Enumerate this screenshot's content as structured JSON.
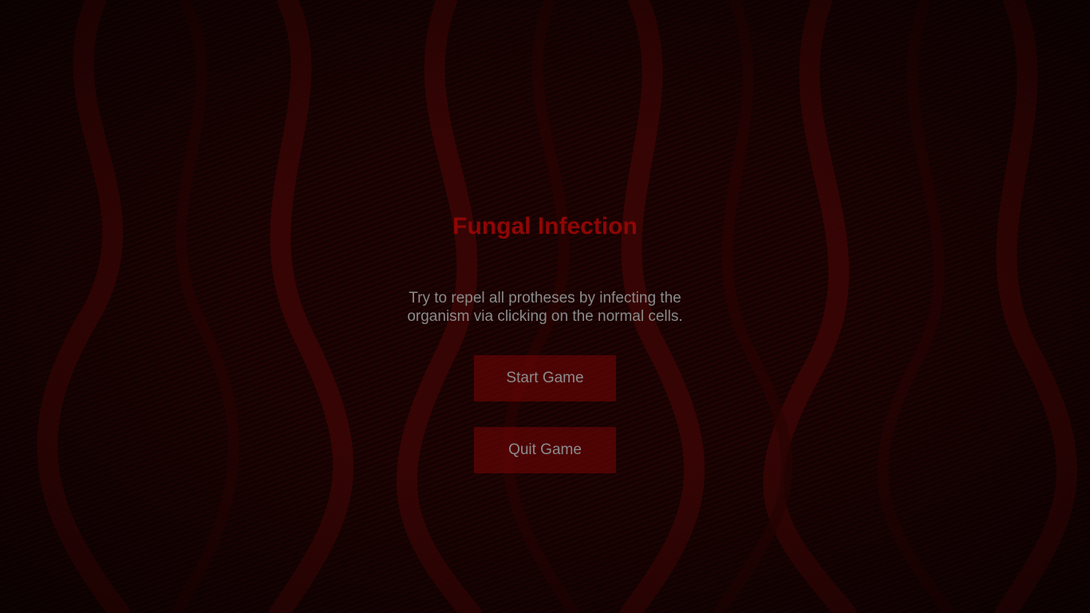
{
  "game": {
    "title": "Fungal Infection",
    "description_lines": [
      "Try to repel all protheses by infecting the",
      "organism via clicking on the normal cells."
    ]
  },
  "buttons": {
    "start_label": "Start Game",
    "quit_label": "Quit Game"
  },
  "colors": {
    "title": "#8f0606",
    "text": "#8b8b8b",
    "button_bg": "#780606",
    "background": "#120101"
  }
}
